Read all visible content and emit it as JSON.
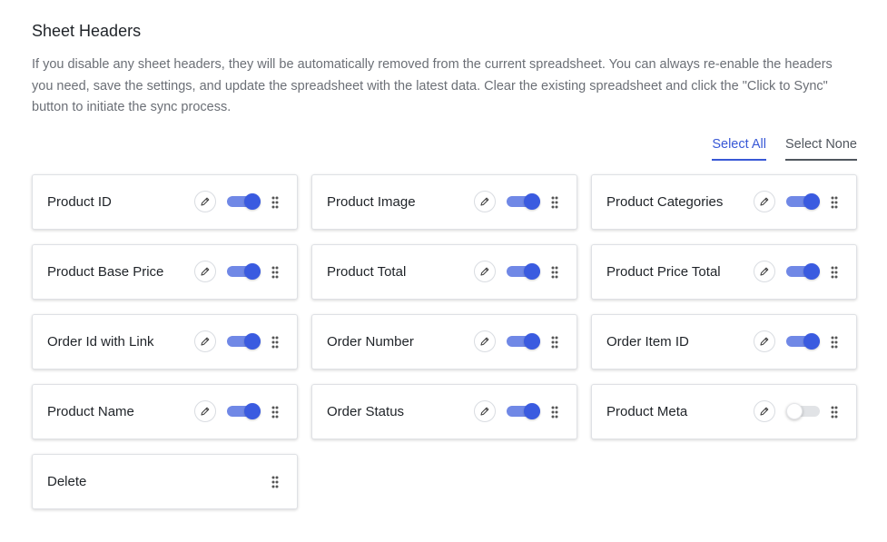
{
  "header": {
    "title": "Sheet Headers",
    "description": "If you disable any sheet headers, they will be automatically removed from the current spreadsheet. You can always re-enable the headers you need, save the settings, and update the spreadsheet with the latest data. Clear the existing spreadsheet and click the \"Click to Sync\" button to initiate the sync process."
  },
  "selection": {
    "select_all_label": "Select All",
    "select_none_label": "Select None"
  },
  "colors": {
    "accent": "#3a5be0",
    "toggle_track_on": "#7088e6",
    "toggle_off": "#e1e3e6",
    "link_active": "#3858d6"
  },
  "headers": [
    {
      "label": "Product ID",
      "enabled": true,
      "editable": true,
      "icons": [
        "pencil-icon",
        "drag-handle-icon"
      ]
    },
    {
      "label": "Product Image",
      "enabled": true,
      "editable": true,
      "icons": [
        "pencil-icon",
        "drag-handle-icon"
      ]
    },
    {
      "label": "Product Categories",
      "enabled": true,
      "editable": true,
      "icons": [
        "pencil-icon",
        "drag-handle-icon"
      ]
    },
    {
      "label": "Product Base Price",
      "enabled": true,
      "editable": true,
      "icons": [
        "pencil-icon",
        "drag-handle-icon"
      ]
    },
    {
      "label": "Product Total",
      "enabled": true,
      "editable": true,
      "icons": [
        "pencil-icon",
        "drag-handle-icon"
      ]
    },
    {
      "label": "Product Price Total",
      "enabled": true,
      "editable": true,
      "icons": [
        "pencil-icon",
        "drag-handle-icon"
      ]
    },
    {
      "label": "Order Id with Link",
      "enabled": true,
      "editable": true,
      "icons": [
        "pencil-icon",
        "drag-handle-icon"
      ]
    },
    {
      "label": "Order Number",
      "enabled": true,
      "editable": true,
      "icons": [
        "pencil-icon",
        "drag-handle-icon"
      ]
    },
    {
      "label": "Order Item ID",
      "enabled": true,
      "editable": true,
      "icons": [
        "pencil-icon",
        "drag-handle-icon"
      ]
    },
    {
      "label": "Product Name",
      "enabled": true,
      "editable": true,
      "icons": [
        "pencil-icon",
        "drag-handle-icon"
      ]
    },
    {
      "label": "Order Status",
      "enabled": true,
      "editable": true,
      "icons": [
        "pencil-icon",
        "drag-handle-icon"
      ]
    },
    {
      "label": "Product Meta",
      "enabled": false,
      "editable": true,
      "icons": [
        "pencil-icon",
        "drag-handle-icon"
      ]
    },
    {
      "label": "Delete",
      "enabled": null,
      "editable": false,
      "icons": [
        "drag-handle-icon"
      ]
    }
  ]
}
